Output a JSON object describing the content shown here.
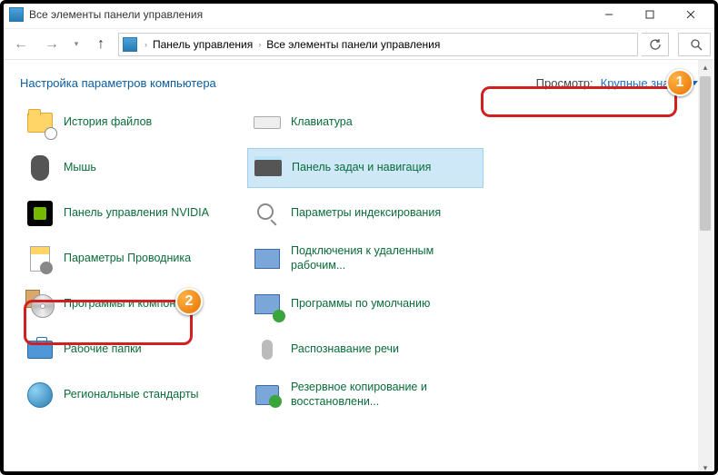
{
  "window": {
    "title": "Все элементы панели управления"
  },
  "breadcrumbs": {
    "a": "Панель управления",
    "b": "Все элементы панели управления"
  },
  "header": {
    "title": "Настройка параметров компьютера",
    "view_label": "Просмотр:",
    "view_value": "Крупные значки"
  },
  "items_left": [
    {
      "label": "История файлов"
    },
    {
      "label": "Мышь"
    },
    {
      "label": "Панель управления NVIDIA"
    },
    {
      "label": "Параметры Проводника"
    },
    {
      "label": "Программы и компоненты"
    },
    {
      "label": "Рабочие папки"
    },
    {
      "label": "Региональные стандарты"
    }
  ],
  "items_right": [
    {
      "label": "Клавиатура"
    },
    {
      "label": "Панель задач и навигация"
    },
    {
      "label": "Параметры индексирования"
    },
    {
      "label": "Подключения к удаленным рабочим..."
    },
    {
      "label": "Программы по умолчанию"
    },
    {
      "label": "Распознавание речи"
    },
    {
      "label": "Резервное копирование и восстановлени..."
    }
  ],
  "annotations": {
    "badge1": "1",
    "badge2": "2"
  }
}
